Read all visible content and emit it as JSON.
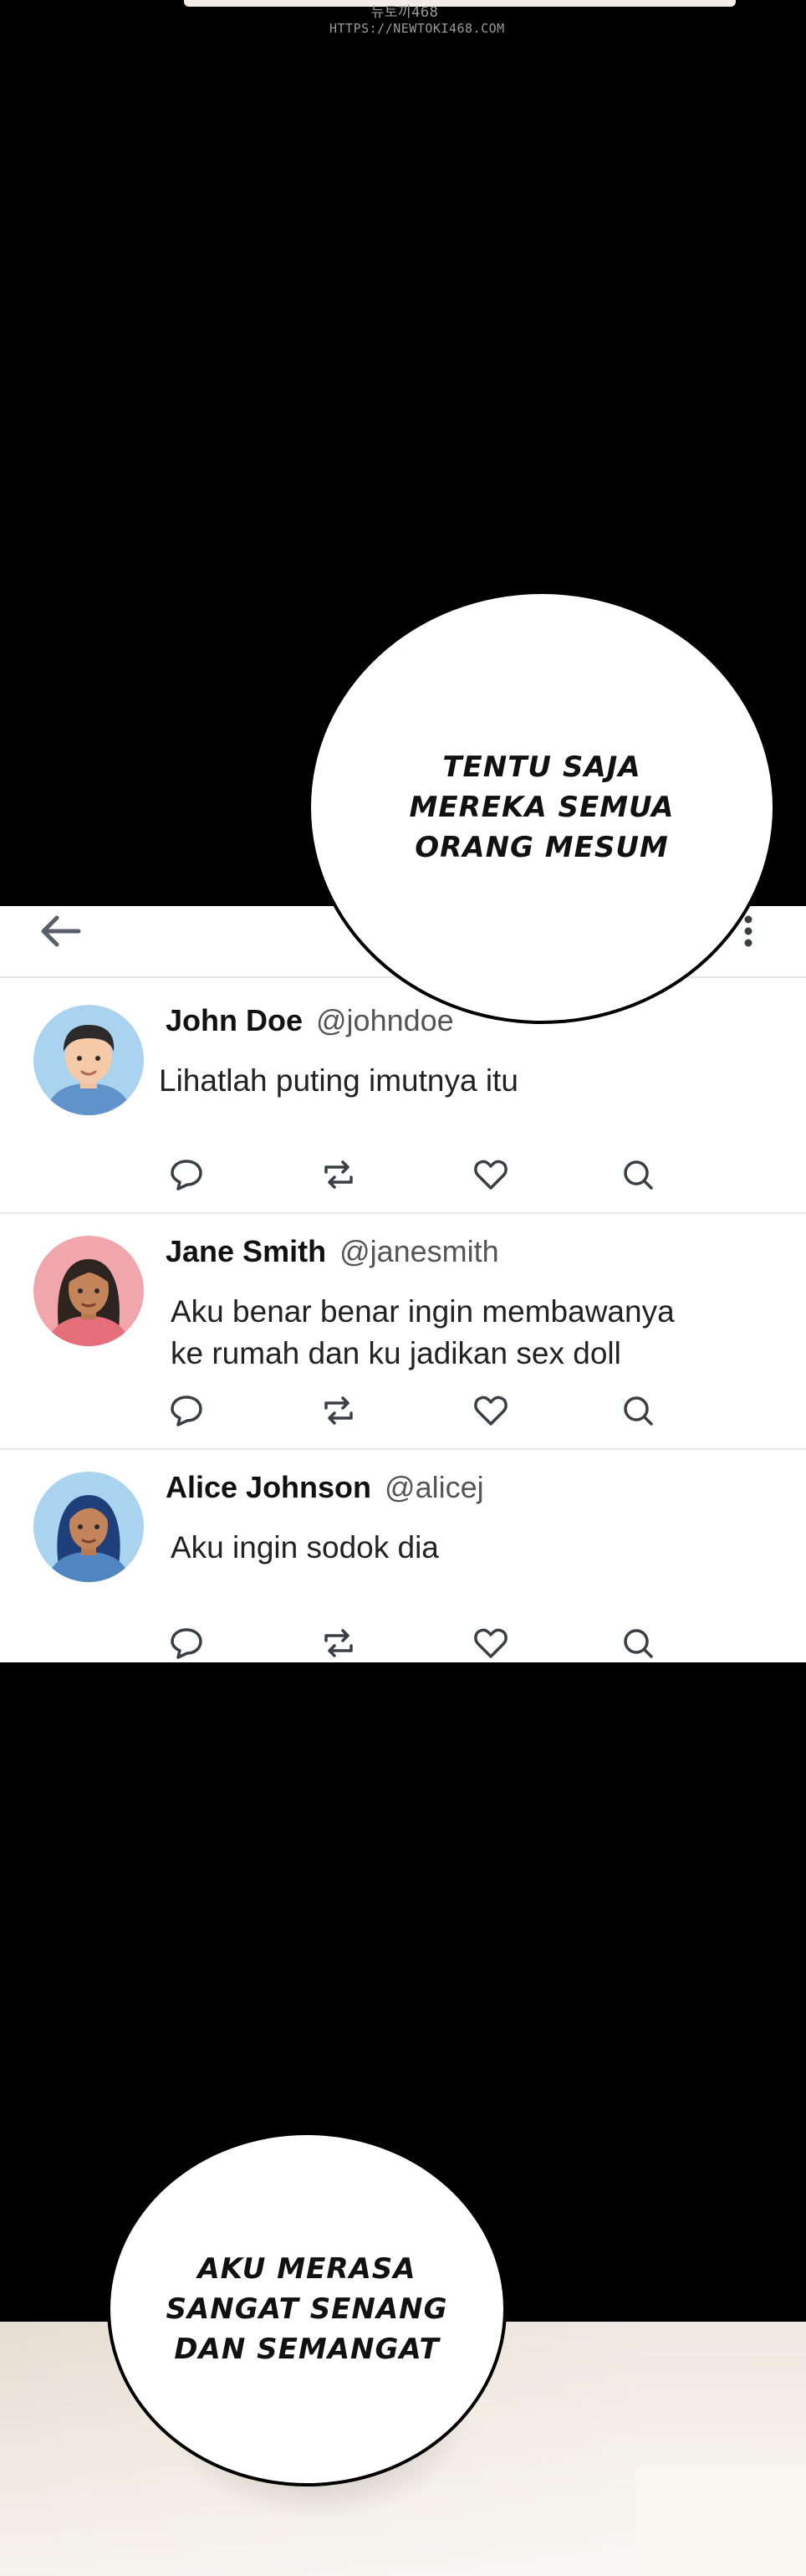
{
  "watermark": {
    "line1": "뉴토끼468",
    "line2": "HTTPS://NEWTOKI468.COM"
  },
  "bubbles": {
    "top": "TENTU SAJA\nMEREKA SEMUA\nORANG MESUM",
    "bottom": "AKU MERASA\nSANGAT SENANG\nDAN SEMANGAT"
  },
  "tweets": [
    {
      "name": "John Doe",
      "handle": "@johndoe",
      "text": "Lihatlah puting imutnya itu",
      "avatar": "male-avatar-icon"
    },
    {
      "name": "Jane Smith",
      "handle": "@janesmith",
      "text": "Aku benar benar ingin membawanya\nke rumah dan ku jadikan sex doll",
      "avatar": "female-avatar-icon"
    },
    {
      "name": "Alice Johnson",
      "handle": "@alicej",
      "text": "Aku ingin sodok dia",
      "avatar": "female-avatar-icon"
    }
  ],
  "icons": {
    "back": "arrow-left-icon",
    "more": "more-vertical-icon",
    "reply": "comment-icon",
    "retweet": "retweet-icon",
    "like": "heart-icon",
    "search": "search-icon"
  },
  "colors": {
    "background": "#000000",
    "panel": "#ffffff",
    "icon": "#3a3f44"
  }
}
